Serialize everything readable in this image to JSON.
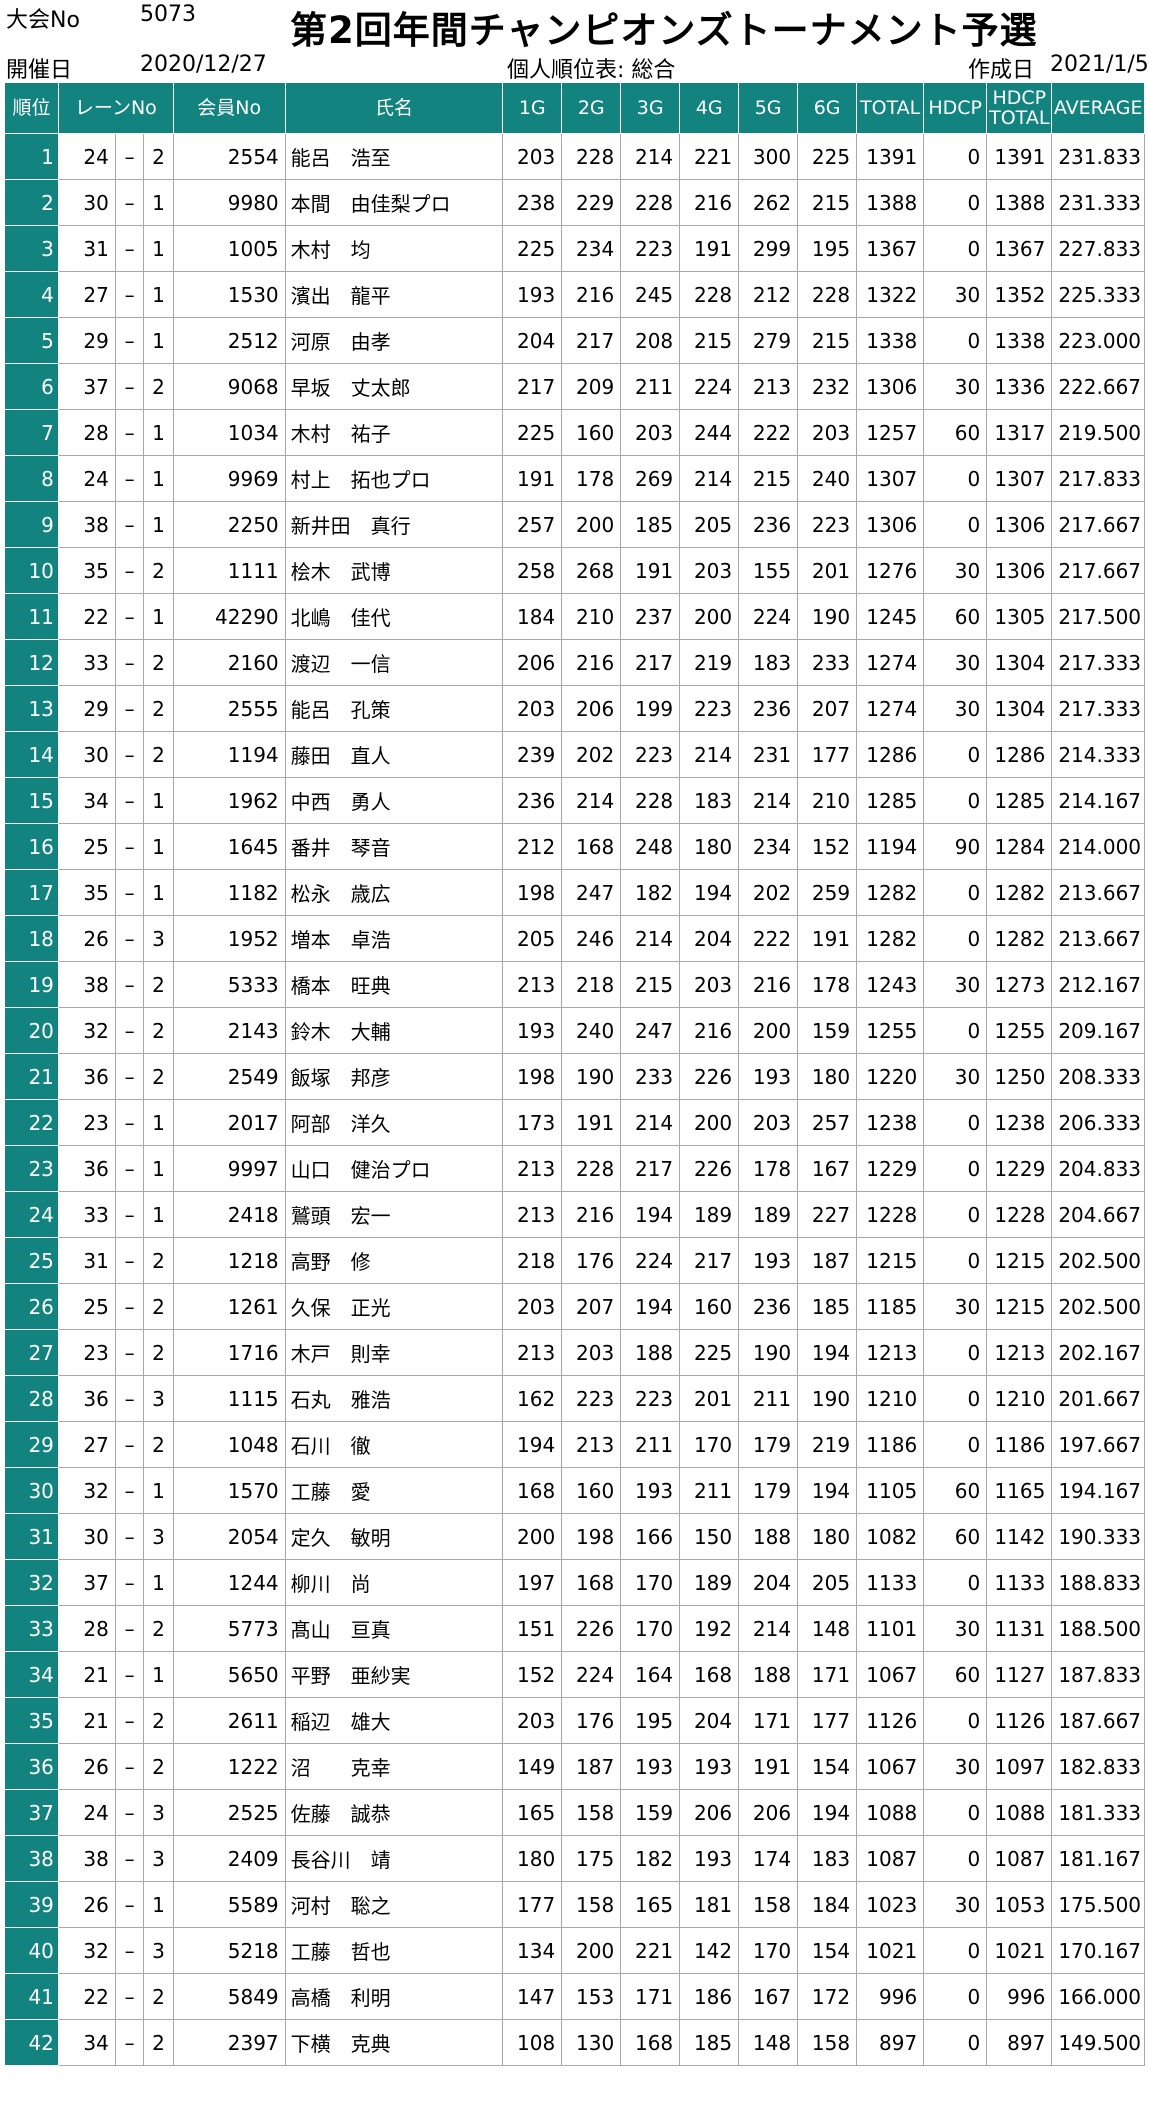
{
  "header": {
    "tournament_no_label": "大会No",
    "tournament_no": "5073",
    "date_label": "開催日",
    "date": "2020/12/27",
    "title": "第2回年間チャンピオンズトーナメント予選",
    "table_label": "個人順位表: 総合",
    "created_label": "作成日",
    "created_date": "2021/1/5"
  },
  "columns": {
    "rank": "順位",
    "lane": "レーンNo",
    "member": "会員No",
    "name": "氏名",
    "g1": "1G",
    "g2": "2G",
    "g3": "3G",
    "g4": "4G",
    "g5": "5G",
    "g6": "6G",
    "total": "TOTAL",
    "hdcp": "HDCP",
    "hdcp_total_line1": "HDCP",
    "hdcp_total_line2": "TOTAL",
    "average": "AVERAGE"
  },
  "rows": [
    [
      "1",
      "24",
      "–",
      "2",
      "2554",
      "能呂　浩至",
      "203",
      "228",
      "214",
      "221",
      "300",
      "225",
      "1391",
      "0",
      "1391",
      "231.833"
    ],
    [
      "2",
      "30",
      "–",
      "1",
      "9980",
      "本間　由佳梨プロ",
      "238",
      "229",
      "228",
      "216",
      "262",
      "215",
      "1388",
      "0",
      "1388",
      "231.333"
    ],
    [
      "3",
      "31",
      "–",
      "1",
      "1005",
      "木村　均",
      "225",
      "234",
      "223",
      "191",
      "299",
      "195",
      "1367",
      "0",
      "1367",
      "227.833"
    ],
    [
      "4",
      "27",
      "–",
      "1",
      "1530",
      "濱出　龍平",
      "193",
      "216",
      "245",
      "228",
      "212",
      "228",
      "1322",
      "30",
      "1352",
      "225.333"
    ],
    [
      "5",
      "29",
      "–",
      "1",
      "2512",
      "河原　由孝",
      "204",
      "217",
      "208",
      "215",
      "279",
      "215",
      "1338",
      "0",
      "1338",
      "223.000"
    ],
    [
      "6",
      "37",
      "–",
      "2",
      "9068",
      "早坂　丈太郎",
      "217",
      "209",
      "211",
      "224",
      "213",
      "232",
      "1306",
      "30",
      "1336",
      "222.667"
    ],
    [
      "7",
      "28",
      "–",
      "1",
      "1034",
      "木村　祐子",
      "225",
      "160",
      "203",
      "244",
      "222",
      "203",
      "1257",
      "60",
      "1317",
      "219.500"
    ],
    [
      "8",
      "24",
      "–",
      "1",
      "9969",
      "村上　拓也プロ",
      "191",
      "178",
      "269",
      "214",
      "215",
      "240",
      "1307",
      "0",
      "1307",
      "217.833"
    ],
    [
      "9",
      "38",
      "–",
      "1",
      "2250",
      "新井田　真行",
      "257",
      "200",
      "185",
      "205",
      "236",
      "223",
      "1306",
      "0",
      "1306",
      "217.667"
    ],
    [
      "10",
      "35",
      "–",
      "2",
      "1111",
      "桧木　武博",
      "258",
      "268",
      "191",
      "203",
      "155",
      "201",
      "1276",
      "30",
      "1306",
      "217.667"
    ],
    [
      "11",
      "22",
      "–",
      "1",
      "42290",
      "北嶋　佳代",
      "184",
      "210",
      "237",
      "200",
      "224",
      "190",
      "1245",
      "60",
      "1305",
      "217.500"
    ],
    [
      "12",
      "33",
      "–",
      "2",
      "2160",
      "渡辺　一信",
      "206",
      "216",
      "217",
      "219",
      "183",
      "233",
      "1274",
      "30",
      "1304",
      "217.333"
    ],
    [
      "13",
      "29",
      "–",
      "2",
      "2555",
      "能呂　孔策",
      "203",
      "206",
      "199",
      "223",
      "236",
      "207",
      "1274",
      "30",
      "1304",
      "217.333"
    ],
    [
      "14",
      "30",
      "–",
      "2",
      "1194",
      "藤田　直人",
      "239",
      "202",
      "223",
      "214",
      "231",
      "177",
      "1286",
      "0",
      "1286",
      "214.333"
    ],
    [
      "15",
      "34",
      "–",
      "1",
      "1962",
      "中西　勇人",
      "236",
      "214",
      "228",
      "183",
      "214",
      "210",
      "1285",
      "0",
      "1285",
      "214.167"
    ],
    [
      "16",
      "25",
      "–",
      "1",
      "1645",
      "番井　琴音",
      "212",
      "168",
      "248",
      "180",
      "234",
      "152",
      "1194",
      "90",
      "1284",
      "214.000"
    ],
    [
      "17",
      "35",
      "–",
      "1",
      "1182",
      "松永　歳広",
      "198",
      "247",
      "182",
      "194",
      "202",
      "259",
      "1282",
      "0",
      "1282",
      "213.667"
    ],
    [
      "18",
      "26",
      "–",
      "3",
      "1952",
      "増本　卓浩",
      "205",
      "246",
      "214",
      "204",
      "222",
      "191",
      "1282",
      "0",
      "1282",
      "213.667"
    ],
    [
      "19",
      "38",
      "–",
      "2",
      "5333",
      "橋本　旺典",
      "213",
      "218",
      "215",
      "203",
      "216",
      "178",
      "1243",
      "30",
      "1273",
      "212.167"
    ],
    [
      "20",
      "32",
      "–",
      "2",
      "2143",
      "鈴木　大輔",
      "193",
      "240",
      "247",
      "216",
      "200",
      "159",
      "1255",
      "0",
      "1255",
      "209.167"
    ],
    [
      "21",
      "36",
      "–",
      "2",
      "2549",
      "飯塚　邦彦",
      "198",
      "190",
      "233",
      "226",
      "193",
      "180",
      "1220",
      "30",
      "1250",
      "208.333"
    ],
    [
      "22",
      "23",
      "–",
      "1",
      "2017",
      "阿部　洋久",
      "173",
      "191",
      "214",
      "200",
      "203",
      "257",
      "1238",
      "0",
      "1238",
      "206.333"
    ],
    [
      "23",
      "36",
      "–",
      "1",
      "9997",
      "山口　健治プロ",
      "213",
      "228",
      "217",
      "226",
      "178",
      "167",
      "1229",
      "0",
      "1229",
      "204.833"
    ],
    [
      "24",
      "33",
      "–",
      "1",
      "2418",
      "鷲頭　宏一",
      "213",
      "216",
      "194",
      "189",
      "189",
      "227",
      "1228",
      "0",
      "1228",
      "204.667"
    ],
    [
      "25",
      "31",
      "–",
      "2",
      "1218",
      "高野　修",
      "218",
      "176",
      "224",
      "217",
      "193",
      "187",
      "1215",
      "0",
      "1215",
      "202.500"
    ],
    [
      "26",
      "25",
      "–",
      "2",
      "1261",
      "久保　正光",
      "203",
      "207",
      "194",
      "160",
      "236",
      "185",
      "1185",
      "30",
      "1215",
      "202.500"
    ],
    [
      "27",
      "23",
      "–",
      "2",
      "1716",
      "木戸　則幸",
      "213",
      "203",
      "188",
      "225",
      "190",
      "194",
      "1213",
      "0",
      "1213",
      "202.167"
    ],
    [
      "28",
      "36",
      "–",
      "3",
      "1115",
      "石丸　雅浩",
      "162",
      "223",
      "223",
      "201",
      "211",
      "190",
      "1210",
      "0",
      "1210",
      "201.667"
    ],
    [
      "29",
      "27",
      "–",
      "2",
      "1048",
      "石川　徹",
      "194",
      "213",
      "211",
      "170",
      "179",
      "219",
      "1186",
      "0",
      "1186",
      "197.667"
    ],
    [
      "30",
      "32",
      "–",
      "1",
      "1570",
      "工藤　愛",
      "168",
      "160",
      "193",
      "211",
      "179",
      "194",
      "1105",
      "60",
      "1165",
      "194.167"
    ],
    [
      "31",
      "30",
      "–",
      "3",
      "2054",
      "定久　敏明",
      "200",
      "198",
      "166",
      "150",
      "188",
      "180",
      "1082",
      "60",
      "1142",
      "190.333"
    ],
    [
      "32",
      "37",
      "–",
      "1",
      "1244",
      "柳川　尚",
      "197",
      "168",
      "170",
      "189",
      "204",
      "205",
      "1133",
      "0",
      "1133",
      "188.833"
    ],
    [
      "33",
      "28",
      "–",
      "2",
      "5773",
      "髙山　亘真",
      "151",
      "226",
      "170",
      "192",
      "214",
      "148",
      "1101",
      "30",
      "1131",
      "188.500"
    ],
    [
      "34",
      "21",
      "–",
      "1",
      "5650",
      "平野　亜紗実",
      "152",
      "224",
      "164",
      "168",
      "188",
      "171",
      "1067",
      "60",
      "1127",
      "187.833"
    ],
    [
      "35",
      "21",
      "–",
      "2",
      "2611",
      "稲辺　雄大",
      "203",
      "176",
      "195",
      "204",
      "171",
      "177",
      "1126",
      "0",
      "1126",
      "187.667"
    ],
    [
      "36",
      "26",
      "–",
      "2",
      "1222",
      "沼　　克幸",
      "149",
      "187",
      "193",
      "193",
      "191",
      "154",
      "1067",
      "30",
      "1097",
      "182.833"
    ],
    [
      "37",
      "24",
      "–",
      "3",
      "2525",
      "佐藤　誠恭",
      "165",
      "158",
      "159",
      "206",
      "206",
      "194",
      "1088",
      "0",
      "1088",
      "181.333"
    ],
    [
      "38",
      "38",
      "–",
      "3",
      "2409",
      "長谷川　靖",
      "180",
      "175",
      "182",
      "193",
      "174",
      "183",
      "1087",
      "0",
      "1087",
      "181.167"
    ],
    [
      "39",
      "26",
      "–",
      "1",
      "5589",
      "河村　聡之",
      "177",
      "158",
      "165",
      "181",
      "158",
      "184",
      "1023",
      "30",
      "1053",
      "175.500"
    ],
    [
      "40",
      "32",
      "–",
      "3",
      "5218",
      "工藤　哲也",
      "134",
      "200",
      "221",
      "142",
      "170",
      "154",
      "1021",
      "0",
      "1021",
      "170.167"
    ],
    [
      "41",
      "22",
      "–",
      "2",
      "5849",
      "高橋　利明",
      "147",
      "153",
      "171",
      "186",
      "167",
      "172",
      "996",
      "0",
      "996",
      "166.000"
    ],
    [
      "42",
      "34",
      "–",
      "2",
      "2397",
      "下横　克典",
      "108",
      "130",
      "168",
      "185",
      "148",
      "158",
      "897",
      "0",
      "897",
      "149.500"
    ]
  ]
}
